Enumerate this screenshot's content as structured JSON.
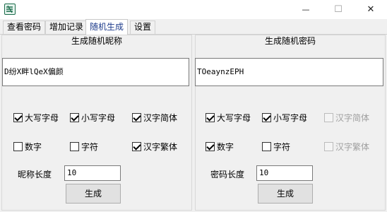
{
  "window": {
    "app_icon": "app-icon",
    "minimize_glyph": "—",
    "maximize_glyph": "☐",
    "close_glyph": "✕"
  },
  "tabs": [
    {
      "label": "查看密码"
    },
    {
      "label": "增加记录"
    },
    {
      "label": "随机生成"
    },
    {
      "label": "设置"
    }
  ],
  "active_tab": "随机生成",
  "nickname": {
    "title": "生成随机昵称",
    "output": "D纷X畔lQeX偏颜",
    "options": [
      {
        "label": "大写字母",
        "checked": true
      },
      {
        "label": "小写字母",
        "checked": true
      },
      {
        "label": "汉字简体",
        "checked": true
      },
      {
        "label": "数字",
        "checked": false
      },
      {
        "label": "字符",
        "checked": false
      },
      {
        "label": "汉字繁体",
        "checked": true
      }
    ],
    "length_label": "昵称长度",
    "length_value": "10",
    "generate_label": "生成"
  },
  "password": {
    "title": "生成随机密码",
    "output": "TOeaynzEPH",
    "options": [
      {
        "label": "大写字母",
        "checked": true,
        "disabled": false
      },
      {
        "label": "小写字母",
        "checked": true,
        "disabled": false
      },
      {
        "label": "汉字简体",
        "checked": false,
        "disabled": true
      },
      {
        "label": "数字",
        "checked": true,
        "disabled": false
      },
      {
        "label": "字符",
        "checked": false,
        "disabled": false
      },
      {
        "label": "汉字繁体",
        "checked": false,
        "disabled": true
      }
    ],
    "length_label": "密码长度",
    "length_value": "10",
    "generate_label": "生成"
  }
}
